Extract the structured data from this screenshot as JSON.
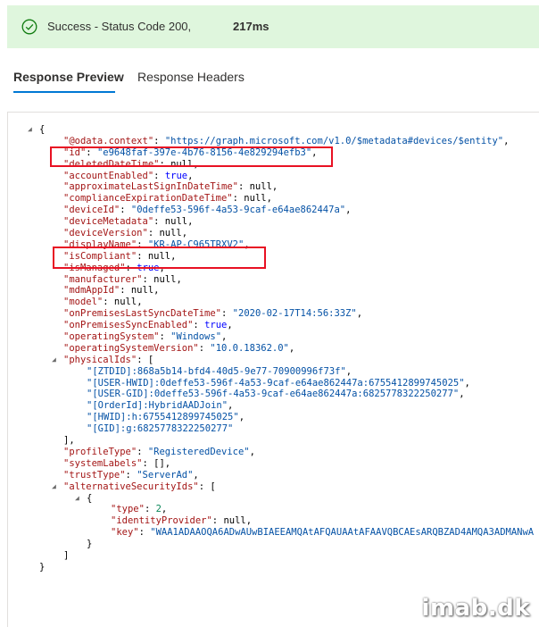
{
  "banner": {
    "status_text": "Success - Status Code 200,",
    "time": "217ms",
    "success_color": "#107c10",
    "background_color": "#dff6dd"
  },
  "tabs": [
    {
      "label": "Response Preview",
      "active": true
    },
    {
      "label": "Response Headers",
      "active": false
    }
  ],
  "accent_color": "#0078d4",
  "highlight_color": "#e81123",
  "json_lines": [
    {
      "indent": 0,
      "fold": true,
      "parts": [
        [
          "p",
          "{"
        ]
      ]
    },
    {
      "indent": 1,
      "parts": [
        [
          "k",
          "\"@odata.context\""
        ],
        [
          "p",
          ": "
        ],
        [
          "s",
          "\"https://graph.microsoft.com/v1.0/$metadata#devices/$entity\""
        ],
        [
          "p",
          ","
        ]
      ]
    },
    {
      "indent": 1,
      "parts": [
        [
          "k",
          "\"id\""
        ],
        [
          "p",
          ": "
        ],
        [
          "s",
          "\"e9648faf-397e-4b76-8156-4e829294efb3\""
        ],
        [
          "p",
          ","
        ]
      ]
    },
    {
      "indent": 1,
      "parts": [
        [
          "k",
          "\"deletedDateTime\""
        ],
        [
          "p",
          ": null,"
        ]
      ]
    },
    {
      "indent": 1,
      "parts": [
        [
          "k",
          "\"accountEnabled\""
        ],
        [
          "p",
          ": "
        ],
        [
          "b",
          "true"
        ],
        [
          "p",
          ","
        ]
      ]
    },
    {
      "indent": 1,
      "parts": [
        [
          "k",
          "\"approximateLastSignInDateTime\""
        ],
        [
          "p",
          ": null,"
        ]
      ]
    },
    {
      "indent": 1,
      "parts": [
        [
          "k",
          "\"complianceExpirationDateTime\""
        ],
        [
          "p",
          ": null,"
        ]
      ]
    },
    {
      "indent": 1,
      "parts": [
        [
          "k",
          "\"deviceId\""
        ],
        [
          "p",
          ": "
        ],
        [
          "s",
          "\"0deffe53-596f-4a53-9caf-e64ae862447a\""
        ],
        [
          "p",
          ","
        ]
      ]
    },
    {
      "indent": 1,
      "parts": [
        [
          "k",
          "\"deviceMetadata\""
        ],
        [
          "p",
          ": null,"
        ]
      ]
    },
    {
      "indent": 1,
      "parts": [
        [
          "k",
          "\"deviceVersion\""
        ],
        [
          "p",
          ": null,"
        ]
      ]
    },
    {
      "indent": 1,
      "parts": [
        [
          "k",
          "\"displayName\""
        ],
        [
          "p",
          ": "
        ],
        [
          "s",
          "\"KR-AP-C965TRXV2\""
        ],
        [
          "p",
          ","
        ]
      ]
    },
    {
      "indent": 1,
      "parts": [
        [
          "k",
          "\"isCompliant\""
        ],
        [
          "p",
          ": null,"
        ]
      ]
    },
    {
      "indent": 1,
      "parts": [
        [
          "k",
          "\"isManaged\""
        ],
        [
          "p",
          ": "
        ],
        [
          "b",
          "true"
        ],
        [
          "p",
          ","
        ]
      ]
    },
    {
      "indent": 1,
      "parts": [
        [
          "k",
          "\"manufacturer\""
        ],
        [
          "p",
          ": null,"
        ]
      ]
    },
    {
      "indent": 1,
      "parts": [
        [
          "k",
          "\"mdmAppId\""
        ],
        [
          "p",
          ": null,"
        ]
      ]
    },
    {
      "indent": 1,
      "parts": [
        [
          "k",
          "\"model\""
        ],
        [
          "p",
          ": null,"
        ]
      ]
    },
    {
      "indent": 1,
      "parts": [
        [
          "k",
          "\"onPremisesLastSyncDateTime\""
        ],
        [
          "p",
          ": "
        ],
        [
          "s",
          "\"2020-02-17T14:56:33Z\""
        ],
        [
          "p",
          ","
        ]
      ]
    },
    {
      "indent": 1,
      "parts": [
        [
          "k",
          "\"onPremisesSyncEnabled\""
        ],
        [
          "p",
          ": "
        ],
        [
          "b",
          "true"
        ],
        [
          "p",
          ","
        ]
      ]
    },
    {
      "indent": 1,
      "parts": [
        [
          "k",
          "\"operatingSystem\""
        ],
        [
          "p",
          ": "
        ],
        [
          "s",
          "\"Windows\""
        ],
        [
          "p",
          ","
        ]
      ]
    },
    {
      "indent": 1,
      "parts": [
        [
          "k",
          "\"operatingSystemVersion\""
        ],
        [
          "p",
          ": "
        ],
        [
          "s",
          "\"10.0.18362.0\""
        ],
        [
          "p",
          ","
        ]
      ]
    },
    {
      "indent": 1,
      "fold": true,
      "parts": [
        [
          "k",
          "\"physicalIds\""
        ],
        [
          "p",
          ": ["
        ]
      ]
    },
    {
      "indent": 2,
      "parts": [
        [
          "s",
          "\"[ZTDID]:868a5b14-bfd4-40d5-9e77-70900996f73f\""
        ],
        [
          "p",
          ","
        ]
      ]
    },
    {
      "indent": 2,
      "parts": [
        [
          "s",
          "\"[USER-HWID]:0deffe53-596f-4a53-9caf-e64ae862447a:6755412899745025\""
        ],
        [
          "p",
          ","
        ]
      ]
    },
    {
      "indent": 2,
      "parts": [
        [
          "s",
          "\"[USER-GID]:0deffe53-596f-4a53-9caf-e64ae862447a:6825778322250277\""
        ],
        [
          "p",
          ","
        ]
      ]
    },
    {
      "indent": 2,
      "parts": [
        [
          "s",
          "\"[OrderId]:HybridAADJoin\""
        ],
        [
          "p",
          ","
        ]
      ]
    },
    {
      "indent": 2,
      "parts": [
        [
          "s",
          "\"[HWID]:h:6755412899745025\""
        ],
        [
          "p",
          ","
        ]
      ]
    },
    {
      "indent": 2,
      "parts": [
        [
          "s",
          "\"[GID]:g:6825778322250277\""
        ]
      ]
    },
    {
      "indent": 1,
      "parts": [
        [
          "p",
          "],"
        ]
      ]
    },
    {
      "indent": 1,
      "parts": [
        [
          "k",
          "\"profileType\""
        ],
        [
          "p",
          ": "
        ],
        [
          "s",
          "\"RegisteredDevice\""
        ],
        [
          "p",
          ","
        ]
      ]
    },
    {
      "indent": 1,
      "parts": [
        [
          "k",
          "\"systemLabels\""
        ],
        [
          "p",
          ": [],"
        ]
      ]
    },
    {
      "indent": 1,
      "parts": [
        [
          "k",
          "\"trustType\""
        ],
        [
          "p",
          ": "
        ],
        [
          "s",
          "\"ServerAd\""
        ],
        [
          "p",
          ","
        ]
      ]
    },
    {
      "indent": 1,
      "fold": true,
      "parts": [
        [
          "k",
          "\"alternativeSecurityIds\""
        ],
        [
          "p",
          ": ["
        ]
      ]
    },
    {
      "indent": 2,
      "fold": true,
      "parts": [
        [
          "p",
          "{"
        ]
      ]
    },
    {
      "indent": 3,
      "parts": [
        [
          "k",
          "\"type\""
        ],
        [
          "p",
          ": "
        ],
        [
          "n",
          "2"
        ],
        [
          "p",
          ","
        ]
      ]
    },
    {
      "indent": 3,
      "parts": [
        [
          "k",
          "\"identityProvider\""
        ],
        [
          "p",
          ": null,"
        ]
      ]
    },
    {
      "indent": 3,
      "parts": [
        [
          "k",
          "\"key\""
        ],
        [
          "p",
          ": "
        ],
        [
          "s",
          "\"WAA1ADAAOQA6ADwAUwBIAEEAMQAtAFQAUAAtAFAAVQBCAEsARQBZAD4AMQA3ADMANwA"
        ]
      ]
    },
    {
      "indent": 2,
      "parts": [
        [
          "p",
          "}"
        ]
      ]
    },
    {
      "indent": 1,
      "parts": [
        [
          "p",
          "]"
        ]
      ]
    },
    {
      "indent": 0,
      "parts": [
        [
          "p",
          "}"
        ]
      ]
    }
  ],
  "watermark": "imab.dk"
}
